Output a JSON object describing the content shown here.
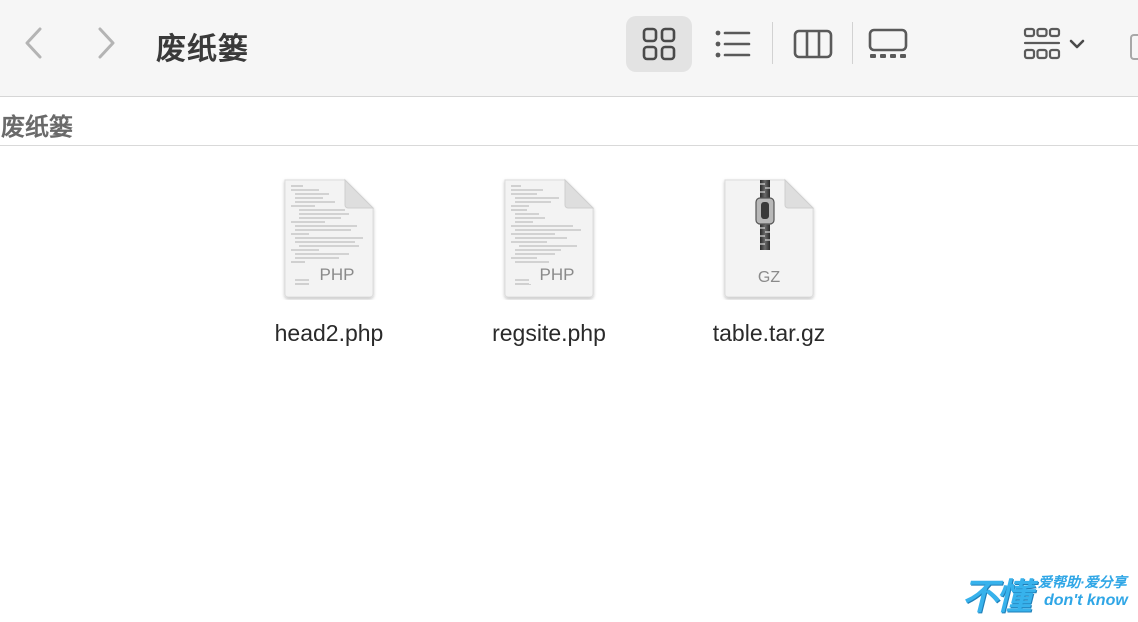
{
  "window": {
    "title": "废纸篓"
  },
  "toolbar": {
    "back_icon": "chevron-left-icon",
    "forward_icon": "chevron-right-icon",
    "views": [
      "icon-view",
      "list-view",
      "column-view",
      "gallery-view"
    ],
    "selected_view": "icon-view",
    "group_icon": "group-grid-icon"
  },
  "pathbar": {
    "label": "废纸篓"
  },
  "files": [
    {
      "name": "head2.php",
      "type_label": "PHP"
    },
    {
      "name": "regsite.php",
      "type_label": "PHP"
    },
    {
      "name": "table.tar.gz",
      "type_label": "GZ"
    }
  ],
  "watermark": {
    "big": "不懂",
    "top": "爱帮助·爱分享",
    "bottom": "don't know"
  },
  "colors": {
    "toolbar_bg": "#f6f6f6",
    "selected_view_bg": "#e3e3e3",
    "watermark": "#37b2ec"
  }
}
